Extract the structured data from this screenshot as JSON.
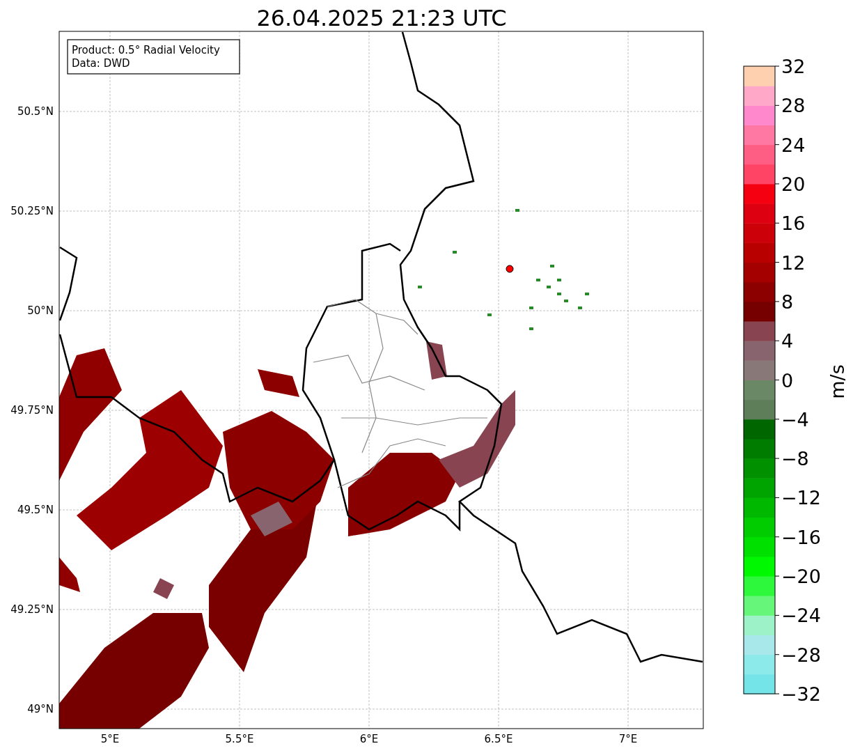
{
  "title": "26.04.2025 21:23 UTC",
  "legend": {
    "lines": [
      "Product: 0.5° Radial Velocity",
      "Data: DWD"
    ]
  },
  "map": {
    "x_ticks": [
      "5°E",
      "5.5°E",
      "6°E",
      "6.5°E",
      "7°E"
    ],
    "y_ticks": [
      "50.5°N",
      "50.25°N",
      "50°N",
      "49.75°N",
      "49.5°N",
      "49.25°N",
      "49°N"
    ]
  },
  "colorbar": {
    "label": "m/s",
    "ticks": [
      "32",
      "28",
      "24",
      "20",
      "16",
      "12",
      "8",
      "4",
      "0",
      "−4",
      "−8",
      "−12",
      "−16",
      "−20",
      "−24",
      "−28",
      "−32"
    ],
    "bins": [
      {
        "color": "#74e4e8"
      },
      {
        "color": "#8ceaea"
      },
      {
        "color": "#a8e8ea"
      },
      {
        "color": "#9ef2c8"
      },
      {
        "color": "#66f67a"
      },
      {
        "color": "#2ef83c"
      },
      {
        "color": "#00f800"
      },
      {
        "color": "#00e000"
      },
      {
        "color": "#00cc00"
      },
      {
        "color": "#00b800"
      },
      {
        "color": "#00a400"
      },
      {
        "color": "#009000"
      },
      {
        "color": "#007c00"
      },
      {
        "color": "#006600"
      },
      {
        "color": "#5e7e5a"
      },
      {
        "color": "#6a8866"
      },
      {
        "color": "#887878"
      },
      {
        "color": "#88646e"
      },
      {
        "color": "#884450"
      },
      {
        "color": "#760000"
      },
      {
        "color": "#8c0000"
      },
      {
        "color": "#a40000"
      },
      {
        "color": "#b80000"
      },
      {
        "color": "#cc0008"
      },
      {
        "color": "#dc0010"
      },
      {
        "color": "#f40010"
      },
      {
        "color": "#ff4466"
      },
      {
        "color": "#ff5e84"
      },
      {
        "color": "#ff78a4"
      },
      {
        "color": "#ff88cc"
      },
      {
        "color": "#ffa8c8"
      },
      {
        "color": "#ffd0b0"
      }
    ]
  }
}
